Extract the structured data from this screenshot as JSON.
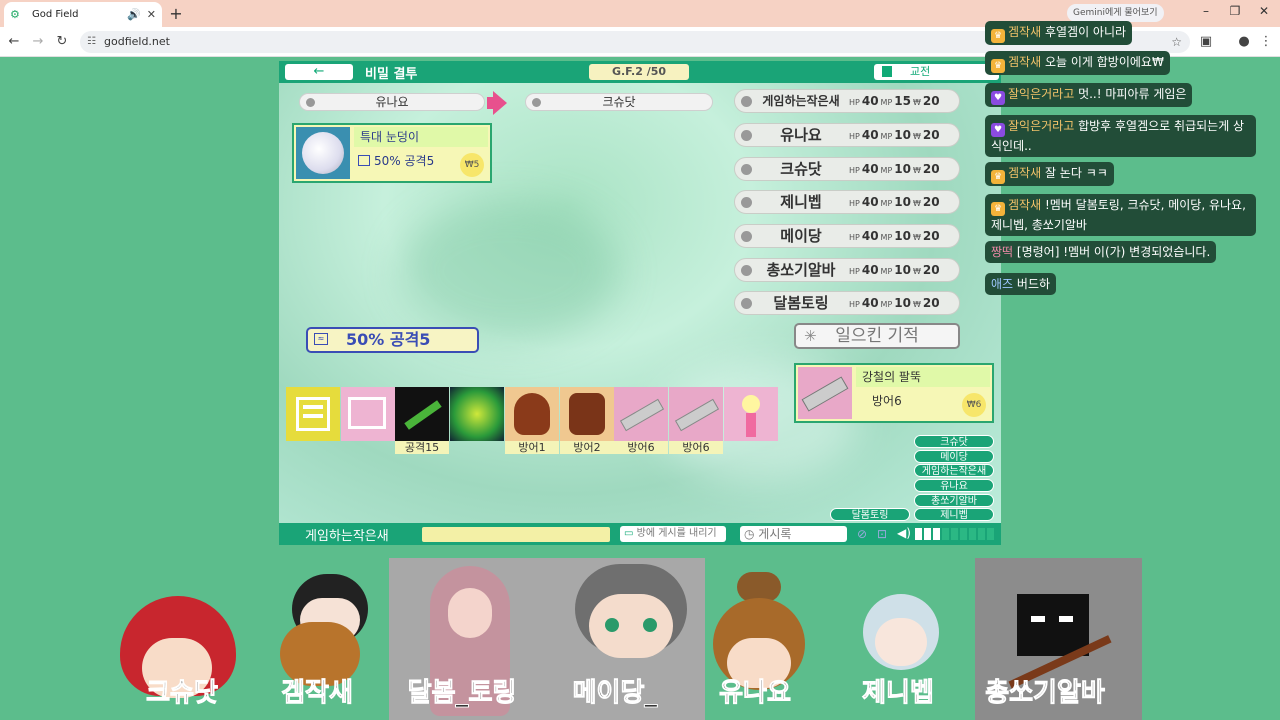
{
  "browser": {
    "tab_title": "God Field",
    "new_tab": "+",
    "url": "godfield.net",
    "gemini": "Gemini에게 물어보기"
  },
  "game": {
    "back": "←",
    "room_title": "비밀 결투",
    "gf_label": "G.F.2 /50",
    "exchange": "교전",
    "attacker": "유나요",
    "target": "크슈닷",
    "attack_card": {
      "name": "특대 눈덩이",
      "desc": "50% 공격5",
      "price": "₩5"
    },
    "current_attack": "50% 공격5",
    "miracle_button": "일으킨 기적",
    "players": [
      {
        "name": "게임하는작은새",
        "hp": "40",
        "mp": "15",
        "won": "20"
      },
      {
        "name": "유나요",
        "hp": "40",
        "mp": "10",
        "won": "20"
      },
      {
        "name": "크슈닷",
        "hp": "40",
        "mp": "10",
        "won": "20"
      },
      {
        "name": "제니벱",
        "hp": "40",
        "mp": "10",
        "won": "20"
      },
      {
        "name": "메이당",
        "hp": "40",
        "mp": "10",
        "won": "20"
      },
      {
        "name": "총쏘기알바",
        "hp": "40",
        "mp": "10",
        "won": "20"
      },
      {
        "name": "달봄토링",
        "hp": "40",
        "mp": "10",
        "won": "20"
      }
    ],
    "stat_labels": {
      "hp": "HP",
      "mp": "MP",
      "won": "₩"
    },
    "hand_labels": [
      "공격15",
      "방어1",
      "방어2",
      "방어6",
      "방어6"
    ],
    "detail_card": {
      "name": "강철의 팔뚝",
      "desc": "방어6",
      "price": "₩6"
    },
    "player_list": [
      "크슈닷",
      "메이당",
      "게임하는작은새",
      "유나요",
      "총쏘기알바",
      "달봄토링",
      "제니벱"
    ],
    "my_name": "게임하는작은새",
    "post_button": "방에 게시를 내리기",
    "board_button": "게시록"
  },
  "chat": [
    {
      "user": "겜작새",
      "text": "후열겜이 아니라"
    },
    {
      "user": "겜작새",
      "text": "오늘 이게 합방이에요₩"
    },
    {
      "user": "잘익은거라고",
      "text": "멋..! 마피아류 게임은"
    },
    {
      "user": "잘익은거라고",
      "text": "합방후 후열겜으로 취급되는게 상식인데.."
    },
    {
      "user": "겜작새",
      "text": "잘 논다 ㅋㅋ"
    },
    {
      "user": "겜작새",
      "text": "!멤버 달봄토링, 크슈닷, 메이당, 유나요, 제니벱, 총쏘기알바"
    },
    {
      "user": "짱떡",
      "text": "[명령어] !멤버 이(가) 변경되었습니다."
    },
    {
      "user": "애즈",
      "text": "버드하"
    }
  ],
  "stream_names": [
    "크슈닷",
    "겜작새",
    "달봄_토링",
    "메이당_",
    "유나요",
    "제니벱",
    "총쏘기알바"
  ],
  "colors": {
    "bg": "#5cbd8c",
    "game_green": "#1aa477",
    "chat_bg": "#224d38",
    "accent_pink": "#e8508d"
  }
}
